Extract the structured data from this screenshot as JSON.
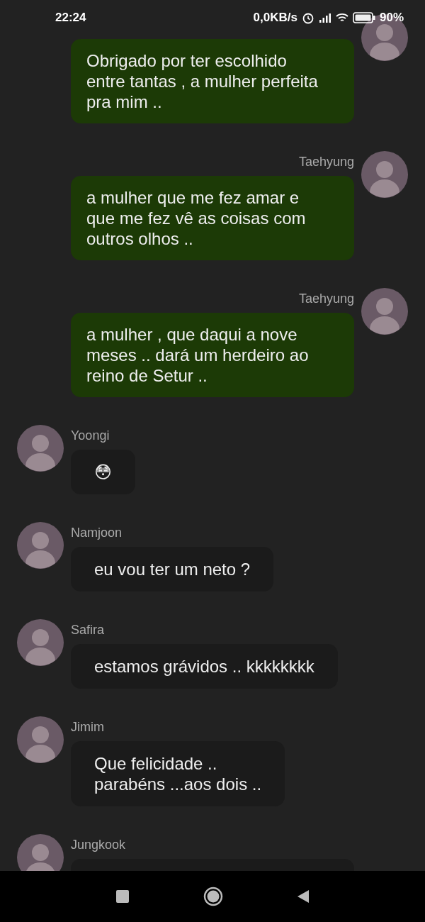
{
  "status_bar": {
    "time": "22:24",
    "speed": "0,0KB/s",
    "battery": "90%"
  },
  "messages": [
    {
      "kind": "out",
      "text": "Obrigado por ter escolhido entre tantas , a mulher perfeita pra mim .."
    },
    {
      "kind": "out",
      "sender": "Taehyung",
      "text": "a mulher que me fez amar e que me fez vê as coisas com outros olhos .."
    },
    {
      "kind": "out",
      "sender": "Taehyung",
      "text": "a mulher , que daqui a nove meses .. dará um herdeiro ao reino de Setur .."
    },
    {
      "kind": "in",
      "sender": "Yoongi",
      "text": "😳"
    },
    {
      "kind": "in",
      "sender": "Namjoon",
      "text": "eu vou ter um neto ?"
    },
    {
      "kind": "in",
      "sender": "Safira",
      "text": "estamos grávidos .. kkkkkkkk"
    },
    {
      "kind": "in",
      "sender": "Jimim",
      "text": "Que felicidade ..\nparabéns ...aos dois .."
    },
    {
      "kind": "in",
      "sender": "Jungkook"
    }
  ]
}
